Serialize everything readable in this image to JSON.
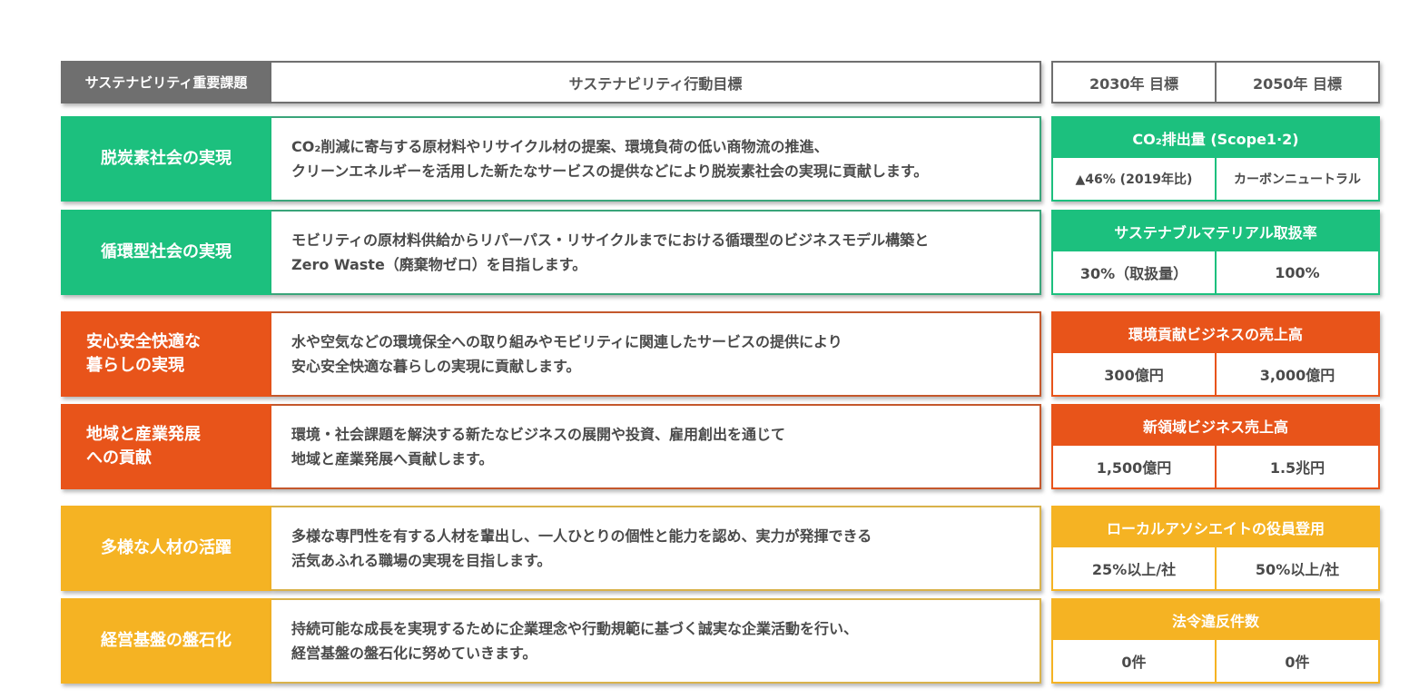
{
  "colors": {
    "header_gray": "#6f6f6f",
    "green": "#1cc07e",
    "green_border": "#3aa57a",
    "orange": "#e8541a",
    "orange_border": "#c4582c",
    "yellow": "#f5b323",
    "yellow_border": "#d9b24a"
  },
  "header": {
    "issue_label": "サステナビリティ重要課題",
    "action_label": "サステナビリティ行動目標",
    "target_2030": "2030年 目標",
    "target_2050": "2050年 目標"
  },
  "rows": [
    {
      "issue": [
        "脱炭素社会の実現"
      ],
      "description": [
        "CO₂削減に寄与する原材料やリサイクル材の提案、環境負荷の低い商物流の推進、",
        "クリーンエネルギーを活用した新たなサービスの提供などにより脱炭素社会の実現に貢献します。"
      ],
      "kpi": "CO₂排出量 (Scope1·2)",
      "target_2030": "▲46% (2019年比)",
      "target_2050": "カーボンニュートラル"
    },
    {
      "issue": [
        "循環型社会の実現"
      ],
      "description": [
        "モビリティの原材料供給からリパーパス・リサイクルまでにおける循環型のビジネスモデル構築と",
        "Zero Waste（廃棄物ゼロ）を目指します。"
      ],
      "kpi": "サステナブルマテリアル取扱率",
      "target_2030": "30%（取扱量）",
      "target_2050": "100%"
    },
    {
      "issue": [
        "安心安全快適な",
        "暮らしの実現"
      ],
      "description": [
        "水や空気などの環境保全への取り組みやモビリティに関連したサービスの提供により",
        "安心安全快適な暮らしの実現に貢献します。"
      ],
      "kpi": "環境貢献ビジネスの売上高",
      "target_2030": "300億円",
      "target_2050": "3,000億円"
    },
    {
      "issue": [
        "地域と産業発展",
        "への貢献"
      ],
      "description": [
        "環境・社会課題を解決する新たなビジネスの展開や投資、雇用創出を通じて",
        "地域と産業発展へ貢献します。"
      ],
      "kpi": "新領域ビジネス売上高",
      "target_2030": "1,500億円",
      "target_2050": "1.5兆円"
    },
    {
      "issue": [
        "多様な人材の活躍"
      ],
      "description": [
        "多様な専門性を有する人材を輩出し、一人ひとりの個性と能力を認め、実力が発揮できる",
        "活気あふれる職場の実現を目指します。"
      ],
      "kpi": "ローカルアソシエイトの役員登用",
      "target_2030": "25%以上/社",
      "target_2050": "50%以上/社"
    },
    {
      "issue": [
        "経営基盤の盤石化"
      ],
      "description": [
        "持続可能な成長を実現するために企業理念や行動規範に基づく誠実な企業活動を行い、",
        "経営基盤の盤石化に努めていきます。"
      ],
      "kpi": "法令違反件数",
      "target_2030": "0件",
      "target_2050": "0件"
    }
  ]
}
